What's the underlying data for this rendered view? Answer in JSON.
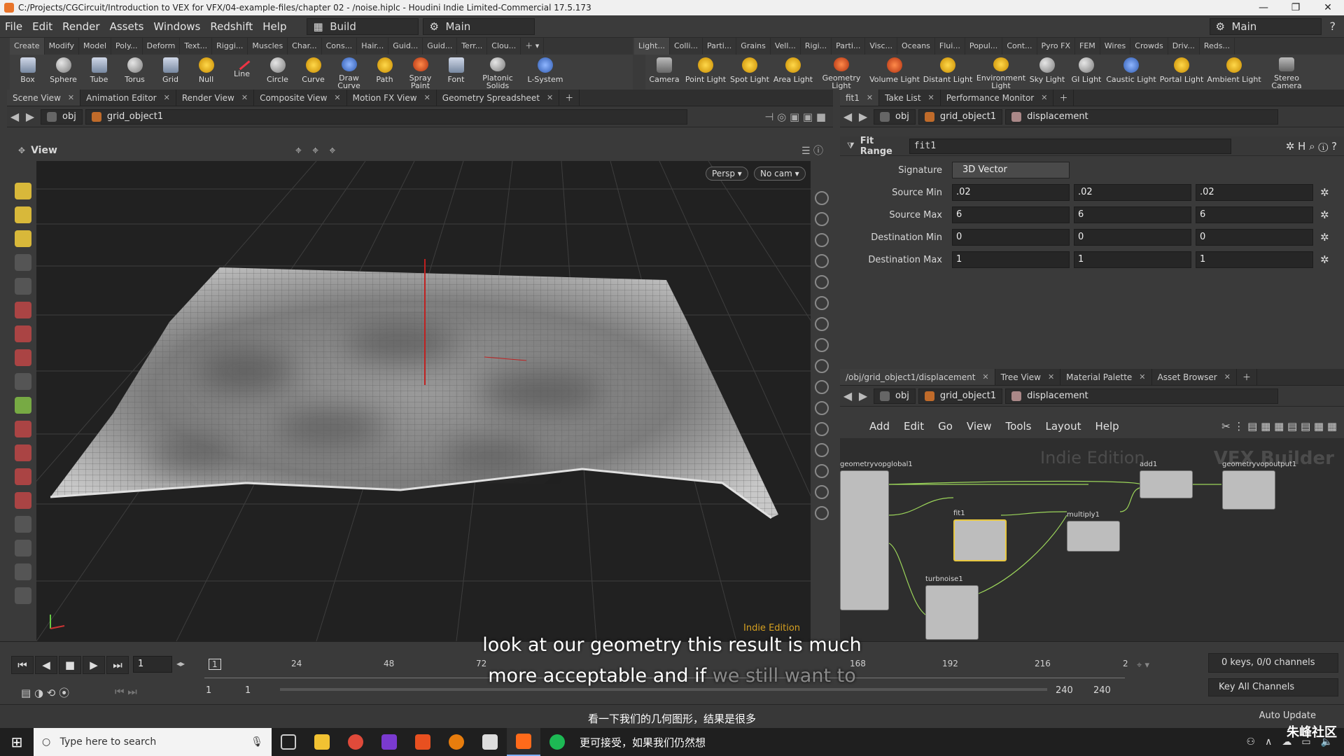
{
  "window": {
    "title": "C:/Projects/CGCircuit/Introduction to VEX for VFX/04-example-files/chapter 02 - /noise.hiplc - Houdini Indie Limited-Commercial 17.5.173",
    "controls": [
      "—",
      "❐",
      "✕"
    ]
  },
  "menu": {
    "items": [
      "File",
      "Edit",
      "Render",
      "Assets",
      "Windows",
      "Redshift",
      "Help"
    ],
    "desktop": "Build",
    "context": "Main",
    "right_context": "Main"
  },
  "shelf_tabs_left": [
    "Create",
    "Modify",
    "Model",
    "Poly...",
    "Deform",
    "Text...",
    "Riggi...",
    "Muscles",
    "Char...",
    "Cons...",
    "Hair...",
    "Guid...",
    "Guid...",
    "Terr...",
    "Clou..."
  ],
  "shelf_tabs_right": [
    "Light...",
    "Colli...",
    "Parti...",
    "Grains",
    "Vell...",
    "Rigi...",
    "Parti...",
    "Visc...",
    "Oceans",
    "Flui...",
    "Popul...",
    "Cont...",
    "Pyro FX",
    "FEM",
    "Wires",
    "Crowds",
    "Driv...",
    "Reds..."
  ],
  "shelf_tools_left": [
    "Box",
    "Sphere",
    "Tube",
    "Torus",
    "Grid",
    "Null",
    "Line",
    "Circle",
    "Curve",
    "Draw Curve",
    "Path",
    "Spray Paint",
    "Font",
    "Platonic Solids",
    "L-System"
  ],
  "shelf_tools_right": [
    "Camera",
    "Point Light",
    "Spot Light",
    "Area Light",
    "Geometry Light",
    "Volume Light",
    "Distant Light",
    "Environment Light",
    "Sky Light",
    "GI Light",
    "Caustic Light",
    "Portal Light",
    "Ambient Light",
    "Stereo Camera"
  ],
  "left_pane": {
    "tabs": [
      "Scene View",
      "Animation Editor",
      "Render View",
      "Composite View",
      "Motion FX View",
      "Geometry Spreadsheet"
    ],
    "path": [
      "obj",
      "grid_object1"
    ],
    "view_label": "View",
    "persp": "Persp ▾",
    "cam": "No cam ▾",
    "edition": "Indie Edition"
  },
  "right_top_pane": {
    "tabs": [
      "fit1",
      "Take List",
      "Performance Monitor"
    ],
    "path": [
      "obj",
      "grid_object1",
      "displacement"
    ],
    "node_type": "Fit Range",
    "node_name": "fit1",
    "signature_label": "Signature",
    "signature_value": "3D Vector",
    "rows": [
      {
        "label": "Source Min",
        "values": [
          ".02",
          ".02",
          ".02"
        ]
      },
      {
        "label": "Source Max",
        "values": [
          "6",
          "6",
          "6"
        ]
      },
      {
        "label": "Destination Min",
        "values": [
          "0",
          "0",
          "0"
        ]
      },
      {
        "label": "Destination Max",
        "values": [
          "1",
          "1",
          "1"
        ]
      }
    ]
  },
  "right_bottom_pane": {
    "tabs": [
      "/obj/grid_object1/displacement",
      "Tree View",
      "Material Palette",
      "Asset Browser"
    ],
    "path": [
      "obj",
      "grid_object1",
      "displacement"
    ],
    "menu": [
      "Add",
      "Edit",
      "Go",
      "View",
      "Tools",
      "Layout",
      "Help"
    ],
    "watermark": "Indie Edition",
    "context_label": "VEX Builder",
    "nodes": [
      "geometryvopglobal1",
      "fit1",
      "multiply1",
      "add1",
      "geometryvopoutput1",
      "turbnoise1"
    ]
  },
  "timeline": {
    "frame": "1",
    "ruler_start": "1",
    "ticks": [
      "24",
      "48",
      "72",
      "168",
      "192",
      "216",
      "2"
    ],
    "range_start": "1",
    "range_start2": "1",
    "range_end": "240",
    "range_end2": "240",
    "keys_info": "0 keys, 0/0 channels",
    "key_all": "Key All Channels",
    "auto_update": "Auto Update"
  },
  "subtitles": {
    "line1": "look at our geometry this result is much",
    "line2_main": "more acceptable and if",
    "line2_dim": "we still want to",
    "cn1": "看一下我们的几何图形，结果是很多",
    "cn2": "更可接受，如果我们仍然想"
  },
  "taskbar": {
    "search_placeholder": "Type here to search",
    "logo": "朱峰社区"
  }
}
